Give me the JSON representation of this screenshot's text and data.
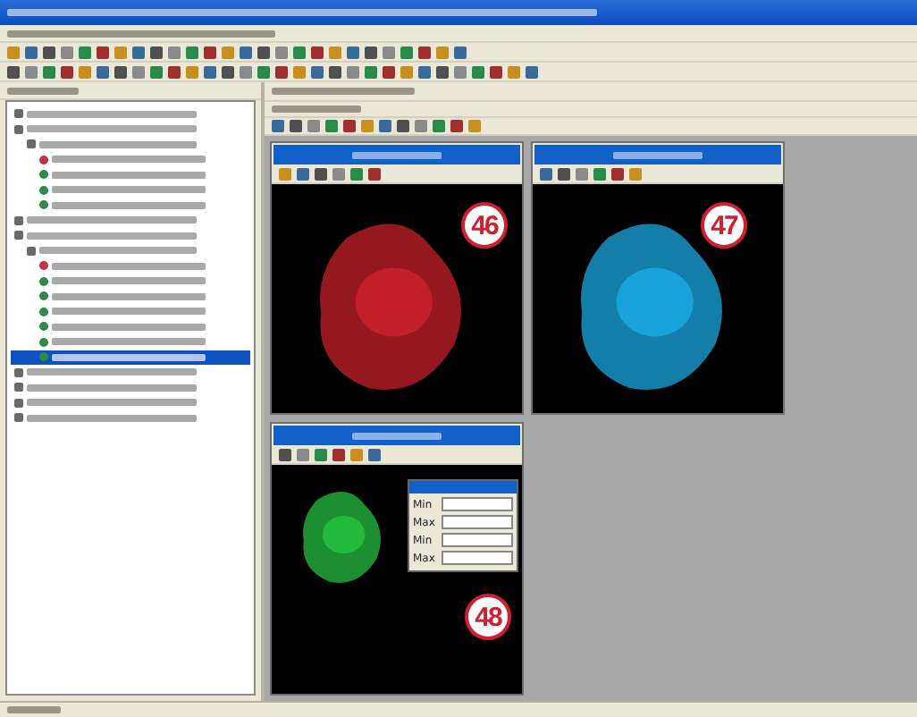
{
  "tree": [
    {
      "kind": "group",
      "selected": false
    },
    {
      "kind": "group",
      "selected": false,
      "children": [
        {
          "kind": "group",
          "selected": false,
          "children": [
            {
              "kind": "channel",
              "color": "#c0304a",
              "selected": false
            },
            {
              "kind": "channel",
              "color": "#2f8a4a",
              "selected": false
            },
            {
              "kind": "channel",
              "color": "#2f8a4a",
              "selected": false
            },
            {
              "kind": "channel",
              "color": "#2f8a4a",
              "selected": false
            }
          ]
        }
      ]
    },
    {
      "kind": "group",
      "selected": false
    },
    {
      "kind": "group",
      "selected": false,
      "children": [
        {
          "kind": "group",
          "selected": false,
          "children": [
            {
              "kind": "channel",
              "color": "#c0304a",
              "selected": false
            },
            {
              "kind": "channel",
              "color": "#2f8a4a",
              "selected": false
            },
            {
              "kind": "channel",
              "color": "#2f8a4a",
              "selected": false
            },
            {
              "kind": "channel",
              "color": "#2f8a4a",
              "selected": false
            },
            {
              "kind": "channel",
              "color": "#2f8a4a",
              "selected": false
            },
            {
              "kind": "channel",
              "color": "#2f8a4a",
              "selected": false
            },
            {
              "kind": "channel",
              "color": "#2f8a4a",
              "selected": true
            }
          ]
        }
      ]
    },
    {
      "kind": "group",
      "selected": false
    },
    {
      "kind": "group",
      "selected": false
    },
    {
      "kind": "group",
      "selected": false
    },
    {
      "kind": "group",
      "selected": false
    }
  ],
  "image_windows": [
    {
      "color": "#c8202a",
      "callout": "46"
    },
    {
      "color": "#1aa8e0",
      "callout": "47"
    },
    {
      "color": "#25c040",
      "callout": "48"
    }
  ],
  "lut_dialog": {
    "rows": [
      {
        "label": "Min"
      },
      {
        "label": "Max"
      },
      {
        "label": "Min"
      },
      {
        "label": "Max"
      }
    ]
  }
}
